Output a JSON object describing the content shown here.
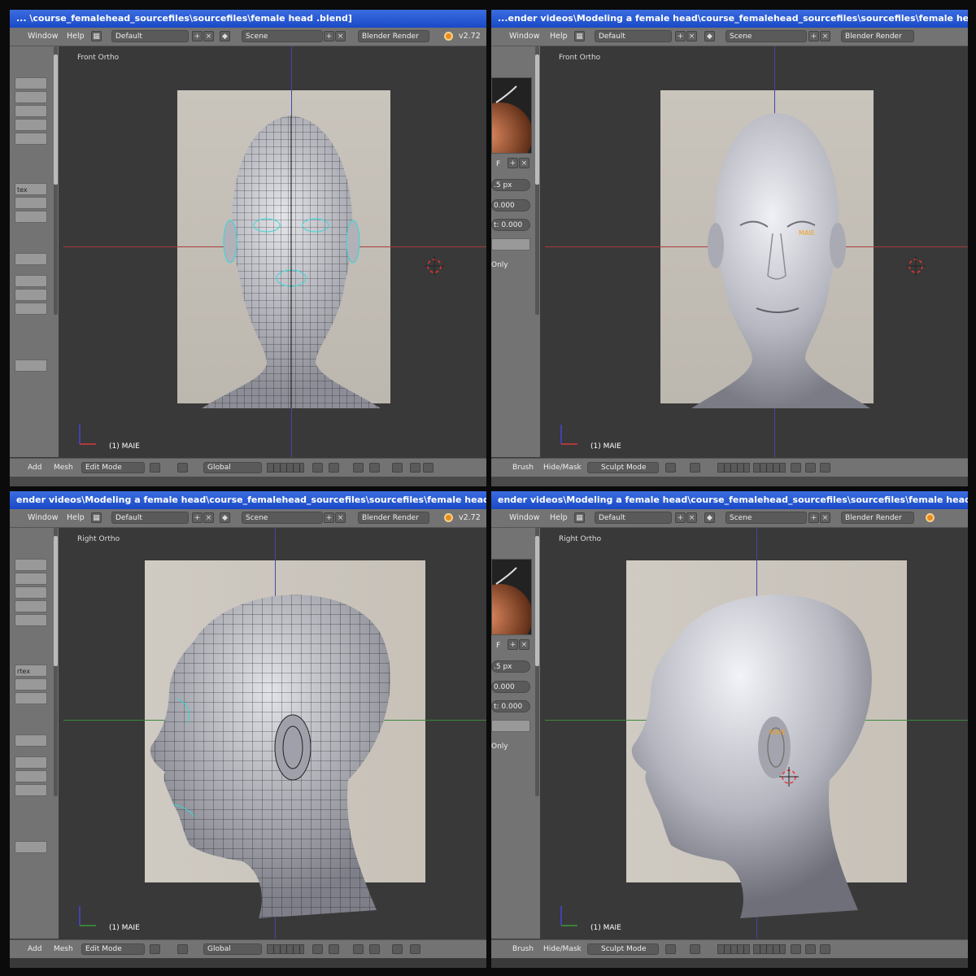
{
  "panels": [
    {
      "title": "... \\course_femalehead_sourcefiles\\sourcefiles\\female head .blend]",
      "menu": {
        "window": "Window",
        "help": "Help",
        "layout": "Default",
        "scene": "Scene",
        "engine": "Blender Render",
        "version": "v2.72"
      },
      "side_items": [
        "",
        "",
        "",
        "",
        "",
        "tex",
        "",
        "",
        "",
        "",
        "",
        "",
        ""
      ],
      "view_label": "Front Ortho",
      "object_label": "(1) MAIE",
      "bottom": {
        "menu1": "Add",
        "menu2": "Mesh",
        "mode": "Edit Mode",
        "orientation": "Global"
      }
    },
    {
      "title": "...ender videos\\Modeling a female head\\course_femalehead_sourcefiles\\sourcefiles\\female head .blend]",
      "menu": {
        "window": "Window",
        "help": "Help",
        "layout": "Default",
        "scene": "Scene",
        "engine": "Blender Render",
        "version": ""
      },
      "props": {
        "f": "F",
        "px": ".5 px",
        "v1": "0.000",
        "v2": "t: 0.000",
        "only": "Only"
      },
      "view_label": "Front Ortho",
      "object_label": "(1) MAIE",
      "name_tag": "MAIE",
      "bottom": {
        "menu1": "Brush",
        "menu2": "Hide/Mask",
        "mode": "Sculpt Mode"
      }
    },
    {
      "title": "ender videos\\Modeling a female head\\course_femalehead_sourcefiles\\sourcefiles\\female head .blend]",
      "menu": {
        "window": "Window",
        "help": "Help",
        "layout": "Default",
        "scene": "Scene",
        "engine": "Blender Render",
        "version": "v2.72"
      },
      "side_items": [
        "",
        "",
        "",
        "",
        "",
        "rtex",
        "",
        "",
        "",
        "",
        "",
        "",
        ""
      ],
      "view_label": "Right Ortho",
      "object_label": "(1) MAIE",
      "bottom": {
        "menu1": "Add",
        "menu2": "Mesh",
        "mode": "Edit Mode",
        "orientation": "Global"
      }
    },
    {
      "title": "ender videos\\Modeling a female head\\course_femalehead_sourcefiles\\sourcefiles\\female head .blend]",
      "menu": {
        "window": "Window",
        "help": "Help",
        "layout": "Default",
        "scene": "Scene",
        "engine": "Blender Render",
        "version": ""
      },
      "props": {
        "f": "F",
        "px": ".5 px",
        "v1": "0.000",
        "v2": "t: 0.000",
        "only": "Only"
      },
      "view_label": "Right Ortho",
      "object_label": "(1) MAIE",
      "name_tag": "MAIE",
      "bottom": {
        "menu1": "Brush",
        "menu2": "Hide/Mask",
        "mode": "Sculpt Mode"
      }
    }
  ],
  "colors": {
    "title_bar": "#1a49c7",
    "menu_bg": "#737373",
    "viewport_bg": "#393939",
    "x_axis": "#a83b3b",
    "y_axis": "#3a8a3a",
    "z_axis": "#4646a8",
    "vertex_select": "#38d6d6",
    "mesh_grey": "#bfc0c8"
  },
  "icons": [
    "blender-logo-icon",
    "plus-icon",
    "close-icon",
    "3d-cursor-icon",
    "axis-gizmo-icon",
    "sphere-shading-icon",
    "brush-icon"
  ]
}
